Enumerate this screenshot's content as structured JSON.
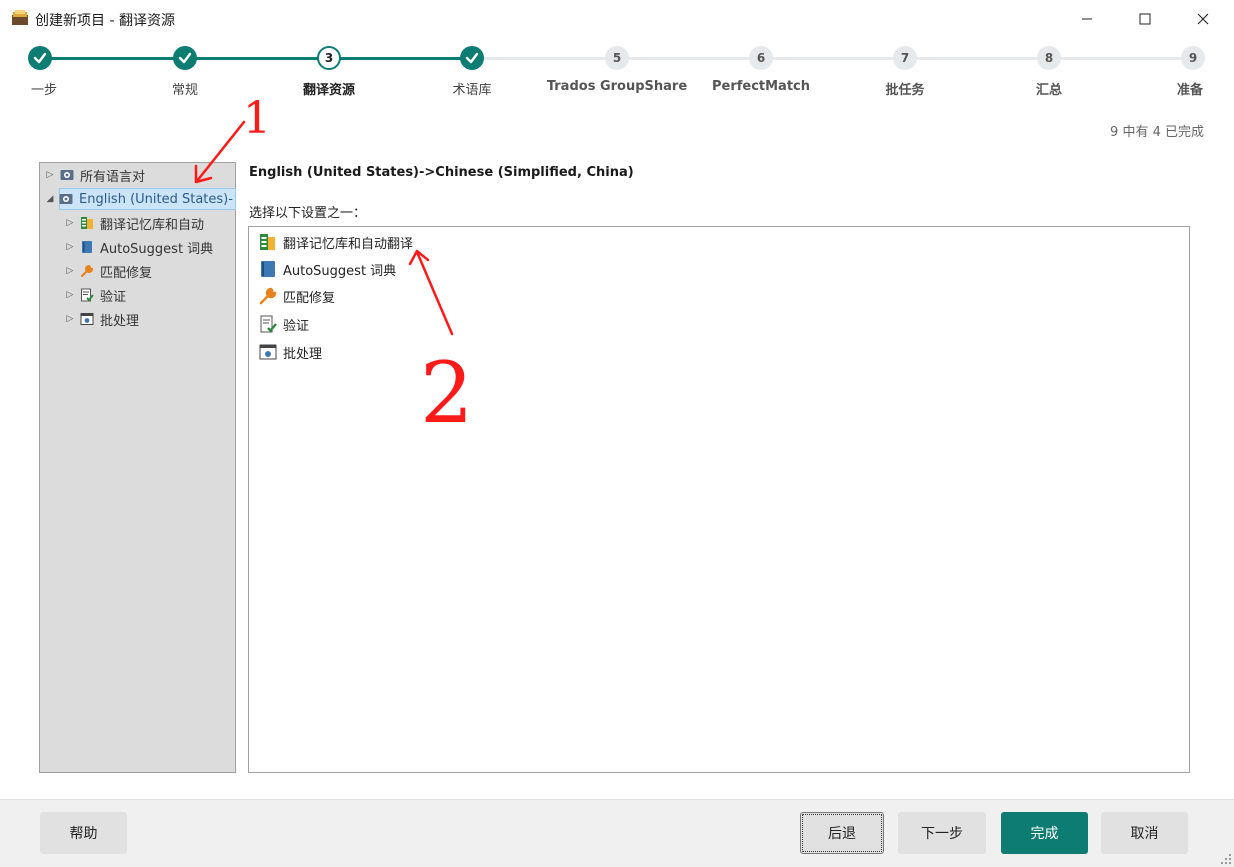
{
  "window": {
    "title": "创建新项目 - 翻译资源"
  },
  "steps": [
    {
      "num": "1",
      "label": "一步",
      "state": "done"
    },
    {
      "num": "2",
      "label": "常规",
      "state": "done"
    },
    {
      "num": "3",
      "label": "翻译资源",
      "state": "current"
    },
    {
      "num": "4",
      "label": "术语库",
      "state": "done"
    },
    {
      "num": "5",
      "label": "Trados GroupShare",
      "state": "future"
    },
    {
      "num": "6",
      "label": "PerfectMatch",
      "state": "future"
    },
    {
      "num": "7",
      "label": "批任务",
      "state": "future"
    },
    {
      "num": "8",
      "label": "汇总",
      "state": "future"
    },
    {
      "num": "9",
      "label": "准备",
      "state": "future"
    }
  ],
  "progress_text": "9 中有 4 已完成",
  "tree": {
    "items": [
      {
        "label": "所有语言对",
        "icon": "language-pair-icon"
      },
      {
        "label": "English (United States)-",
        "icon": "language-pair-icon",
        "selected": true
      },
      {
        "label": "翻译记忆库和自动",
        "icon": "translation-memory-icon"
      },
      {
        "label": "AutoSuggest 词典",
        "icon": "dictionary-icon"
      },
      {
        "label": "匹配修复",
        "icon": "wrench-icon"
      },
      {
        "label": "验证",
        "icon": "verify-icon"
      },
      {
        "label": "批处理",
        "icon": "batch-icon"
      }
    ]
  },
  "main": {
    "language_header": "English (United States)->Chinese (Simplified, China)",
    "choose_label": "选择以下设置之一：",
    "settings": [
      {
        "label": "翻译记忆库和自动翻译",
        "icon": "translation-memory-icon"
      },
      {
        "label": "AutoSuggest 词典",
        "icon": "dictionary-icon"
      },
      {
        "label": "匹配修复",
        "icon": "wrench-icon"
      },
      {
        "label": "验证",
        "icon": "verify-icon"
      },
      {
        "label": "批处理",
        "icon": "batch-icon"
      }
    ]
  },
  "annotations": {
    "mark1": "1",
    "mark2": "2",
    "color": "#ff1a1a"
  },
  "footer": {
    "help": "帮助",
    "back": "后退",
    "next": "下一步",
    "finish": "完成",
    "cancel": "取消"
  },
  "colors": {
    "accent": "#0d7d73",
    "future_node": "#e6e9ec"
  }
}
